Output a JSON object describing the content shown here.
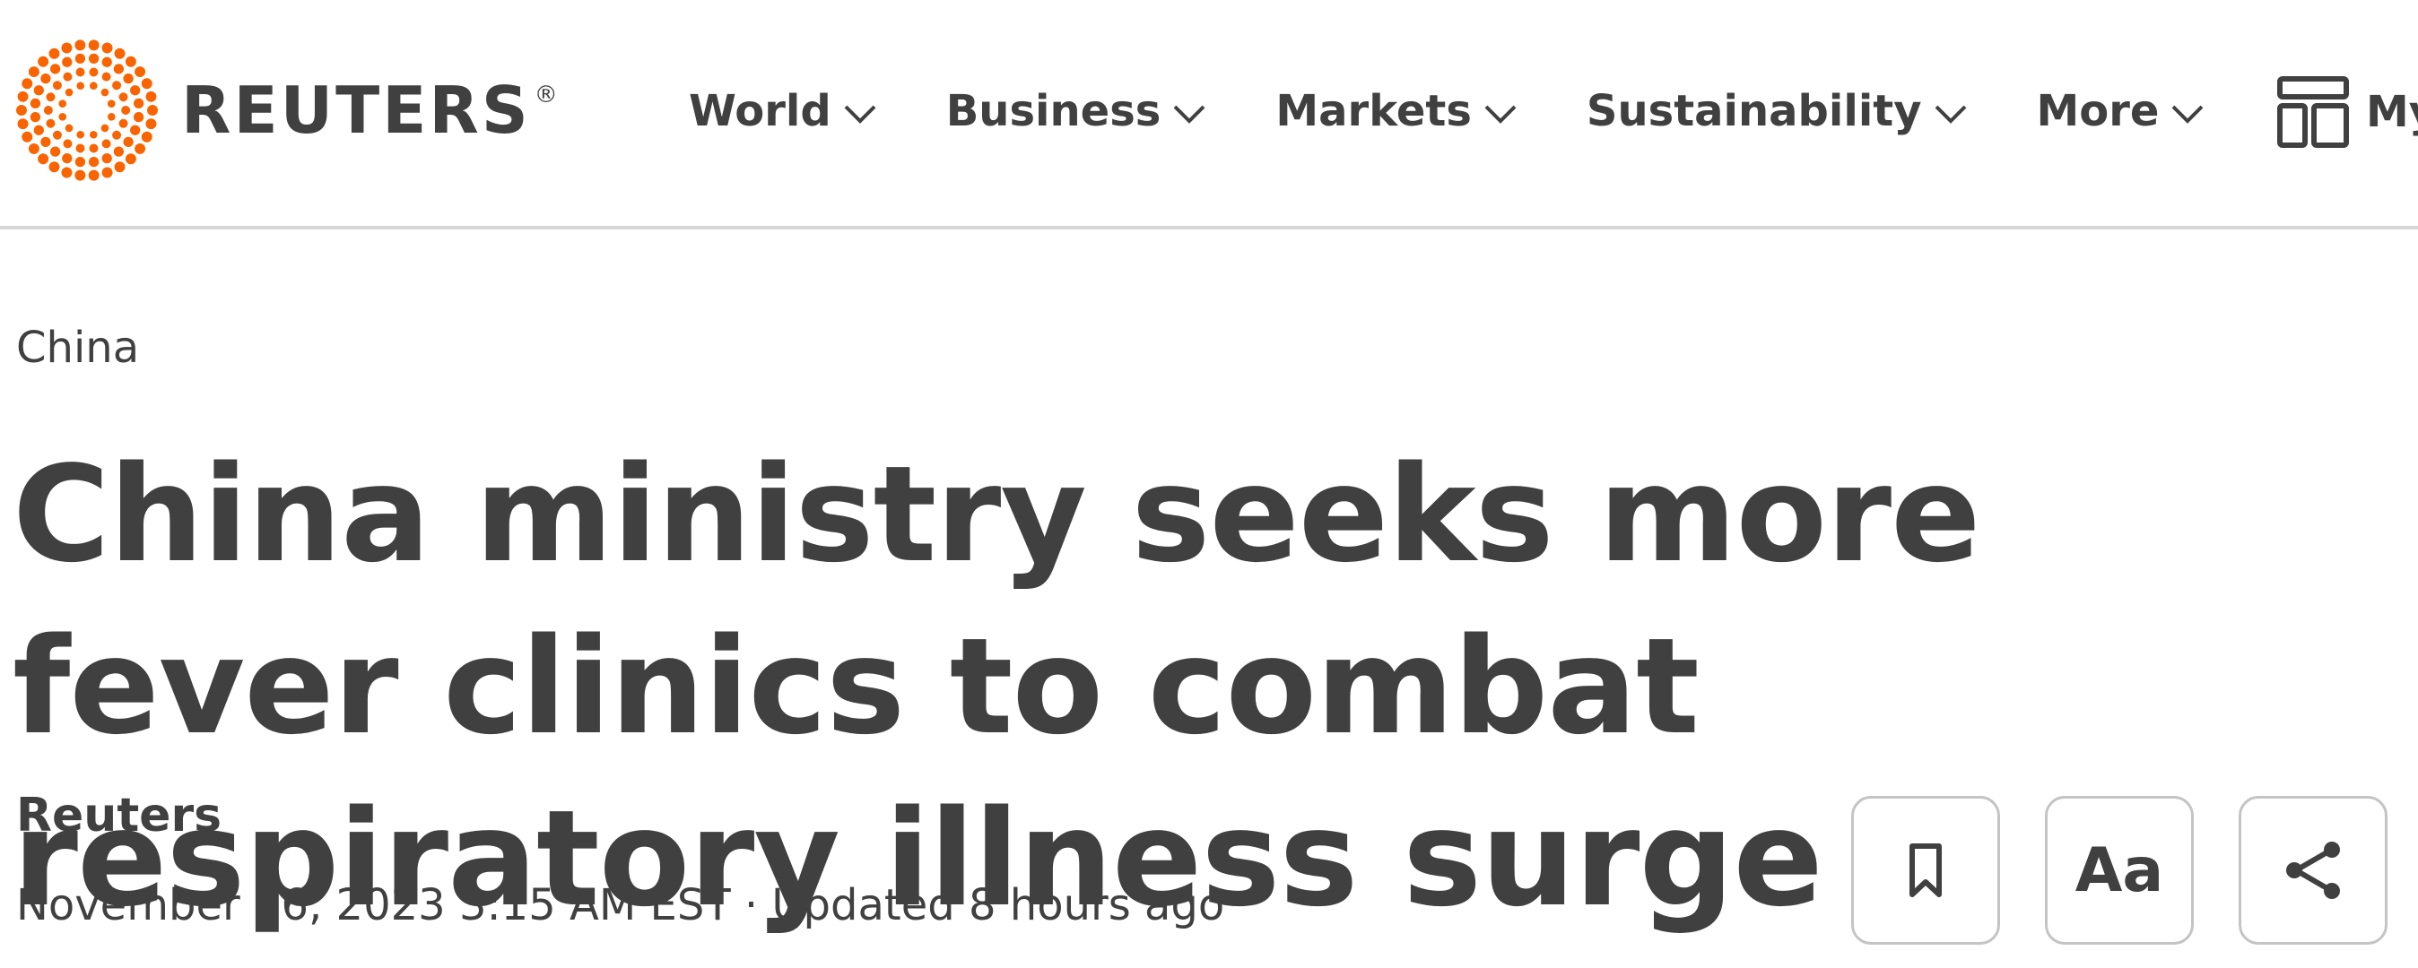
{
  "brand": {
    "name": "REUTERS",
    "registered_mark": "®",
    "logo_icon": "reuters-dot-ring-logo",
    "logo_color": "#fa6400"
  },
  "nav": {
    "items": [
      {
        "label": "World",
        "icon": "chevron-down-icon"
      },
      {
        "label": "Business",
        "icon": "chevron-down-icon"
      },
      {
        "label": "Markets",
        "icon": "chevron-down-icon"
      },
      {
        "label": "Sustainability",
        "icon": "chevron-down-icon"
      },
      {
        "label": "More",
        "icon": "chevron-down-icon"
      }
    ],
    "my_news": {
      "label": "My News",
      "icon": "layout-grid-icon"
    }
  },
  "article": {
    "section": "China",
    "headline": "China ministry seeks more fever clinics to combat respiratory illness surge",
    "byline": "Reuters",
    "dateline": "November 26, 2023 3:15 AM EST · Updated 8 hours ago"
  },
  "actions": {
    "bookmark_icon": "bookmark-icon",
    "text_size_label": "Aa",
    "share_icon": "share-icon"
  },
  "colors": {
    "text": "#404040",
    "divider": "#d6d6d6",
    "button_border": "#c4c4c4",
    "accent": "#fa6400"
  }
}
